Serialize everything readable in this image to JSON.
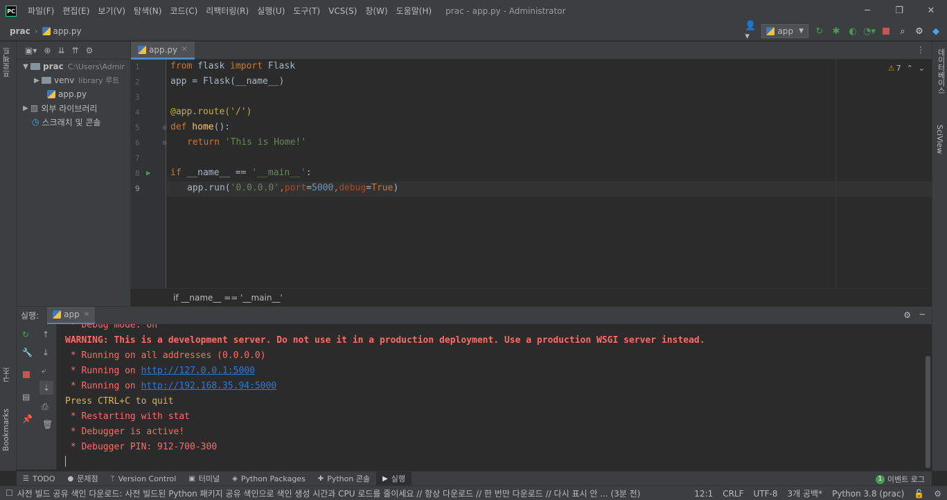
{
  "menu": [
    "파일(F)",
    "편집(E)",
    "보기(V)",
    "탐색(N)",
    "코드(C)",
    "리팩터링(R)",
    "실행(U)",
    "도구(T)",
    "VCS(S)",
    "창(W)",
    "도움말(H)"
  ],
  "window_title": "prac - app.py - Administrator",
  "app_logo": "PC",
  "nav": {
    "project": "prac",
    "file": "app.py",
    "run_config": "app"
  },
  "left_tabs": {
    "project": "프로젝트",
    "structure": "구조",
    "bookmarks": "Bookmarks"
  },
  "right_tabs": {
    "database": "데이터베이스",
    "sciview": "SciView"
  },
  "project_tree": {
    "root": "prac",
    "root_path": "C:\\Users\\Admir",
    "venv": "venv",
    "venv_hint": "library 루트",
    "file": "app.py",
    "external": "외부 라이브러리",
    "scratches": "스크래치 및 콘솔"
  },
  "editor": {
    "tab": "app.py",
    "warning_count": "7",
    "line_numbers": [
      "1",
      "2",
      "3",
      "4",
      "5",
      "6",
      "7",
      "8",
      "9"
    ],
    "breadcrumb": "if __name__ == '__main__'"
  },
  "code": {
    "l1_from": "from",
    "l1_mod": " flask ",
    "l1_import": "import",
    "l1_name": " Flask",
    "l2": "app = Flask(__name__)",
    "l4": "@app.route('/')",
    "l5_def": "def",
    "l5_fn": " home",
    "l5_rest": "():",
    "l6_ret": "return",
    "l6_str": " 'This is Home!'",
    "l8_if": "if",
    "l8_rest": " __name__ == ",
    "l8_str": "'__main__'",
    "l8_colon": ":",
    "l9_a": "app.run(",
    "l9_s": "'0.0.0.0'",
    "l9_c1": ",",
    "l9_p": "port",
    "l9_eq1": "=",
    "l9_n": "5000",
    "l9_c2": ",",
    "l9_d": "debug",
    "l9_eq2": "=",
    "l9_t": "True",
    "l9_end": ")"
  },
  "run": {
    "label": "실행:",
    "tab": "app",
    "lines": {
      "debug_mode": " * Debug mode: on",
      "warning": "WARNING: This is a development server. Do not use it in a production deployment. Use a production WSGI server instead.",
      "all_addr": " * Running on all addresses (0.0.0.0)",
      "running1_prefix": " * Running on ",
      "url1": "http://127.0.0.1:5000",
      "running2_prefix": " * Running on ",
      "url2": "http://192.168.35.94:5000",
      "quit": "Press CTRL+C to quit",
      "restart": " * Restarting with stat",
      "debugger": " * Debugger is active!",
      "pin": " * Debugger PIN: 912-700-300"
    }
  },
  "bottom_tools": [
    "TODO",
    "문제점",
    "Version Control",
    "터미널",
    "Python Packages",
    "Python 콘솔",
    "실행"
  ],
  "event_log": {
    "count": "1",
    "label": "이벤트 로그"
  },
  "status": {
    "message": "사전 빌드 공유 색인 다운로드: 사전 빌드된 Python 패키지 공유 색인으로 색인 생성 시간과 CPU 로드를 줄이세요 // 항상 다운로드 // 한 번만 다운로드 // 다시 표시 안 ... (3분 전)",
    "position": "12:1",
    "line_sep": "CRLF",
    "encoding": "UTF-8",
    "indent": "3개 공백*",
    "interpreter": "Python 3.8 (prac)"
  },
  "colors": {
    "accent": "#4a88c7",
    "run_green": "#499c54",
    "stop_red": "#c75450"
  }
}
